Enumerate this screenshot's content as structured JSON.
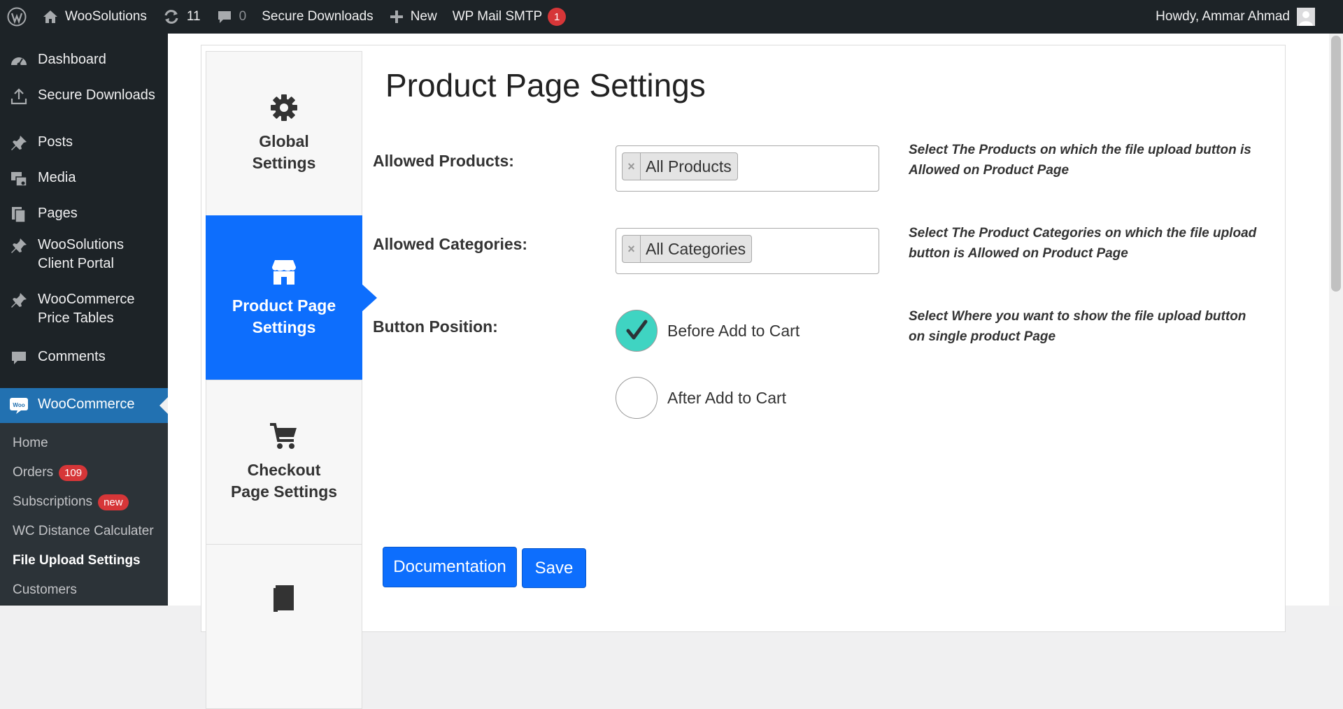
{
  "adminbar": {
    "site_name": "WooSolutions",
    "updates_count": "11",
    "comments_count": "0",
    "secure_downloads": "Secure Downloads",
    "new_label": "New",
    "mail_smtp": "WP Mail SMTP",
    "mail_smtp_badge": "1",
    "greeting": "Howdy, Ammar Ahmad"
  },
  "sidebar": {
    "items": [
      {
        "label": "Dashboard",
        "icon": "dashboard-icon"
      },
      {
        "label": "Secure Downloads",
        "icon": "upload-icon"
      },
      {
        "label": "Posts",
        "icon": "pin-icon"
      },
      {
        "label": "Media",
        "icon": "media-icon"
      },
      {
        "label": "Pages",
        "icon": "pages-icon"
      },
      {
        "label_line1": "WooSolutions",
        "label_line2": "Client Portal",
        "icon": "pin-icon"
      },
      {
        "label_line1": "WooCommerce",
        "label_line2": "Price Tables",
        "icon": "pin-icon"
      },
      {
        "label": "Comments",
        "icon": "comment-icon"
      },
      {
        "label": "WooCommerce",
        "icon": "woo-icon"
      }
    ],
    "woo_icon_text": "Woo",
    "submenu": {
      "home": "Home",
      "orders": "Orders",
      "orders_badge": "109",
      "subscriptions": "Subscriptions",
      "subscriptions_badge": "new",
      "distance": "WC Distance Calculater",
      "file_upload": "File Upload Settings",
      "customers": "Customers"
    }
  },
  "tabs": {
    "global_line1": "Global",
    "global_line2": "Settings",
    "product_line1": "Product Page",
    "product_line2": "Settings",
    "checkout_line1": "Checkout",
    "checkout_line2": "Page Settings"
  },
  "main": {
    "title": "Product Page Settings",
    "allowed_products_label": "Allowed Products:",
    "allowed_products_chip": "All Products",
    "allowed_products_help": "Select The Products on which the file upload button is Allowed on Product Page",
    "allowed_categories_label": "Allowed Categories:",
    "allowed_categories_chip": "All Categories",
    "allowed_categories_help": "Select The Product Categories on which the file upload button is Allowed on Product Page",
    "button_position_label": "Button Position:",
    "button_position_help": "Select Where you want to show the file upload button on single product Page",
    "option_before": "Before Add to Cart",
    "option_after": "After Add to Cart",
    "chip_remove": "×",
    "documentation_button": "Documentation",
    "save_button": "Save"
  },
  "colors": {
    "adminbar_bg": "#1d2327",
    "accent_blue": "#0d6efd",
    "wp_blue": "#2271b1",
    "radio_checked": "#3fd4c2",
    "badge_red": "#d63638"
  }
}
